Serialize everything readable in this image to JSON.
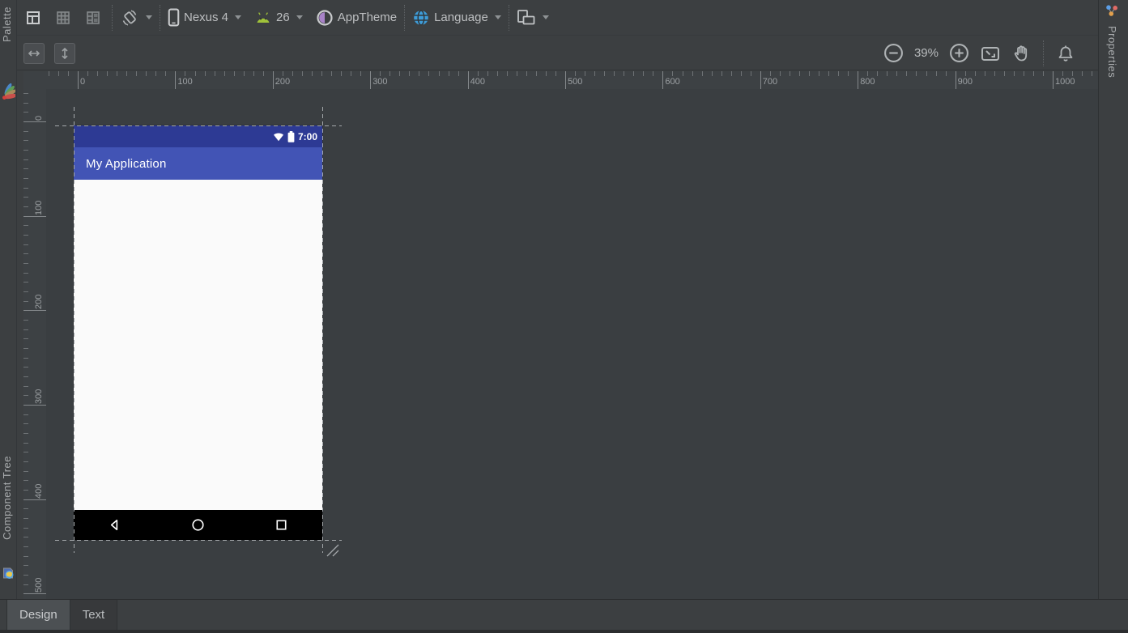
{
  "toolbar": {
    "device": "Nexus 4",
    "api_level": "26",
    "theme": "AppTheme",
    "language": "Language",
    "zoom_level": "39%"
  },
  "docks": {
    "palette": "Palette",
    "component_tree": "Component Tree",
    "properties": "Properties"
  },
  "rulers": {
    "horizontal": [
      "0",
      "100",
      "200",
      "300",
      "400",
      "500",
      "600",
      "700",
      "800",
      "900",
      "1000"
    ],
    "vertical": [
      "0",
      "100",
      "200",
      "300",
      "400",
      "500"
    ]
  },
  "preview": {
    "time": "7:00",
    "app_title": "My Application"
  },
  "tabs": {
    "design": "Design",
    "text": "Text"
  },
  "icons": [
    "design-view-icon",
    "blueprint-view-icon",
    "split-view-icon",
    "rotate-device-icon",
    "phone-device-icon",
    "android-icon",
    "theme-icon",
    "globe-icon",
    "variant-icon",
    "match-width-icon",
    "match-height-icon",
    "zoom-out-icon",
    "zoom-in-icon",
    "fit-screen-icon",
    "pan-hand-icon",
    "bell-icon",
    "palette-tool-icon",
    "component-tree-tool-icon",
    "properties-tool-icon",
    "wifi-icon",
    "battery-icon",
    "back-icon",
    "home-icon",
    "recents-icon",
    "resize-handle-icon"
  ],
  "colors": {
    "status_bar": "#2D3A94",
    "app_bar": "#4254B5",
    "phone_content": "#FAFAFA",
    "nav_bar": "#000000",
    "android_green": "#A0C23A",
    "globe_blue": "#3E9CD8",
    "theme_purple": "#A983C9",
    "toolbar_bg": "#3C3F41",
    "canvas_bg": "#3A3E41"
  }
}
